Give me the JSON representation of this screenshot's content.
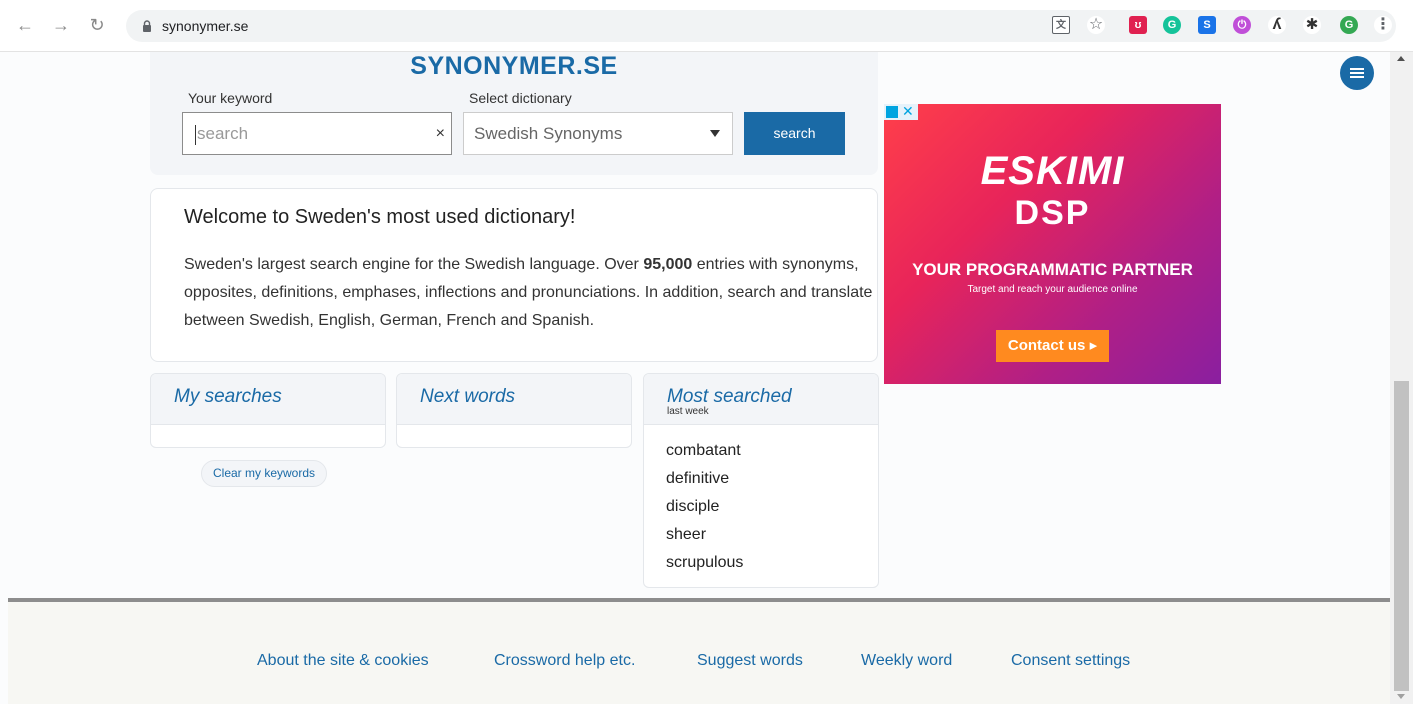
{
  "browser": {
    "url": "synonymer.se",
    "avatar_letter": "G"
  },
  "site": {
    "logo": "SYNONYMER.SE"
  },
  "search": {
    "keyword_label": "Your keyword",
    "keyword_placeholder": "search",
    "dictionary_label": "Select dictionary",
    "dictionary_selected": "Swedish Synonyms",
    "button_label": "search"
  },
  "welcome": {
    "title": "Welcome to Sweden's most used dictionary!",
    "text_before": "Sweden's largest search engine for the Swedish language. Over ",
    "count": "95,000",
    "text_after": " entries with synonyms, opposites, definitions, emphases, inflections and pronunciations. In addition, search and translate between Swedish, English, German, French and Spanish."
  },
  "boxes": {
    "my_searches": "My searches",
    "next_words": "Next words",
    "most_searched": "Most searched",
    "most_searched_sub": "last week",
    "clear_button": "Clear my keywords",
    "words": [
      "combatant",
      "definitive",
      "disciple",
      "sheer",
      "scrupulous"
    ]
  },
  "ad": {
    "brand": "ESKIMI",
    "product": "DSP",
    "tagline": "YOUR PROGRAMMATIC PARTNER",
    "subline": "Target and reach your audience online",
    "cta": "Contact us ▸"
  },
  "footer": {
    "links": [
      "About the site & cookies",
      "Crossword help etc.",
      "Suggest words",
      "Weekly word",
      "Consent settings"
    ]
  },
  "colors": {
    "brand_blue": "#1a6aa6",
    "ad_cta": "#ff8a1f"
  }
}
